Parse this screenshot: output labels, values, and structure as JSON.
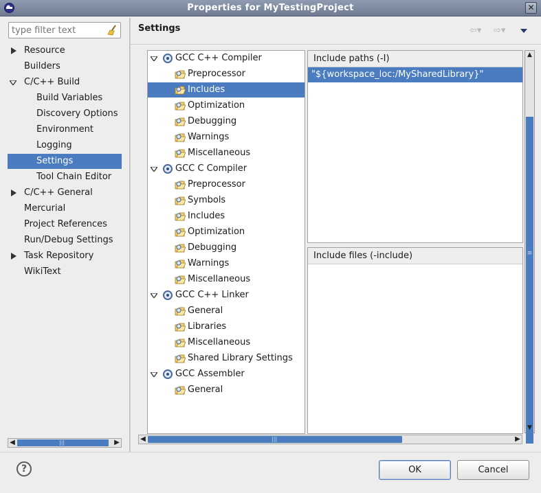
{
  "window": {
    "title": "Properties for MyTestingProject"
  },
  "filter": {
    "placeholder": "type filter text"
  },
  "left_tree": [
    {
      "label": "Resource",
      "twisty": "collapsed",
      "indent": 0
    },
    {
      "label": "Builders",
      "twisty": "none",
      "indent": 0
    },
    {
      "label": "C/C++ Build",
      "twisty": "expanded",
      "indent": 0
    },
    {
      "label": "Build Variables",
      "twisty": "none",
      "indent": 1
    },
    {
      "label": "Discovery Options",
      "twisty": "none",
      "indent": 1
    },
    {
      "label": "Environment",
      "twisty": "none",
      "indent": 1
    },
    {
      "label": "Logging",
      "twisty": "none",
      "indent": 1
    },
    {
      "label": "Settings",
      "twisty": "none",
      "indent": 1,
      "selected": true
    },
    {
      "label": "Tool Chain Editor",
      "twisty": "none",
      "indent": 1
    },
    {
      "label": "C/C++ General",
      "twisty": "collapsed",
      "indent": 0
    },
    {
      "label": "Mercurial",
      "twisty": "none",
      "indent": 0
    },
    {
      "label": "Project References",
      "twisty": "none",
      "indent": 0
    },
    {
      "label": "Run/Debug Settings",
      "twisty": "none",
      "indent": 0
    },
    {
      "label": "Task Repository",
      "twisty": "collapsed",
      "indent": 0
    },
    {
      "label": "WikiText",
      "twisty": "none",
      "indent": 0
    }
  ],
  "page": {
    "title": "Settings"
  },
  "tool_tree": [
    {
      "label": "GCC C++ Compiler",
      "kind": "tool",
      "icon": "gear-icon"
    },
    {
      "label": "Preprocessor",
      "kind": "option",
      "icon": "option-category-icon"
    },
    {
      "label": "Includes",
      "kind": "option",
      "icon": "option-category-icon",
      "selected": true
    },
    {
      "label": "Optimization",
      "kind": "option",
      "icon": "option-category-icon"
    },
    {
      "label": "Debugging",
      "kind": "option",
      "icon": "option-category-icon"
    },
    {
      "label": "Warnings",
      "kind": "option",
      "icon": "option-category-icon"
    },
    {
      "label": "Miscellaneous",
      "kind": "option",
      "icon": "option-category-icon"
    },
    {
      "label": "GCC C Compiler",
      "kind": "tool",
      "icon": "gear-icon"
    },
    {
      "label": "Preprocessor",
      "kind": "option",
      "icon": "option-category-icon"
    },
    {
      "label": "Symbols",
      "kind": "option",
      "icon": "option-category-icon"
    },
    {
      "label": "Includes",
      "kind": "option",
      "icon": "option-category-icon"
    },
    {
      "label": "Optimization",
      "kind": "option",
      "icon": "option-category-icon"
    },
    {
      "label": "Debugging",
      "kind": "option",
      "icon": "option-category-icon"
    },
    {
      "label": "Warnings",
      "kind": "option",
      "icon": "option-category-icon"
    },
    {
      "label": "Miscellaneous",
      "kind": "option",
      "icon": "option-category-icon"
    },
    {
      "label": "GCC C++ Linker",
      "kind": "tool",
      "icon": "gear-icon"
    },
    {
      "label": "General",
      "kind": "option",
      "icon": "option-category-icon"
    },
    {
      "label": "Libraries",
      "kind": "option",
      "icon": "option-category-icon"
    },
    {
      "label": "Miscellaneous",
      "kind": "option",
      "icon": "option-category-icon"
    },
    {
      "label": "Shared Library Settings",
      "kind": "option",
      "icon": "option-category-icon"
    },
    {
      "label": "GCC Assembler",
      "kind": "tool",
      "icon": "gear-icon"
    },
    {
      "label": "General",
      "kind": "option",
      "icon": "option-category-icon"
    }
  ],
  "include_paths": {
    "header": "Include paths (-I)",
    "items": [
      "\"${workspace_loc:/MySharedLibrary}\""
    ]
  },
  "include_files": {
    "header": "Include files (-include)",
    "items": []
  },
  "buttons": {
    "ok": "OK",
    "cancel": "Cancel"
  },
  "colors": {
    "selection": "#4a7cbf",
    "titlebar": "#7d889e"
  }
}
